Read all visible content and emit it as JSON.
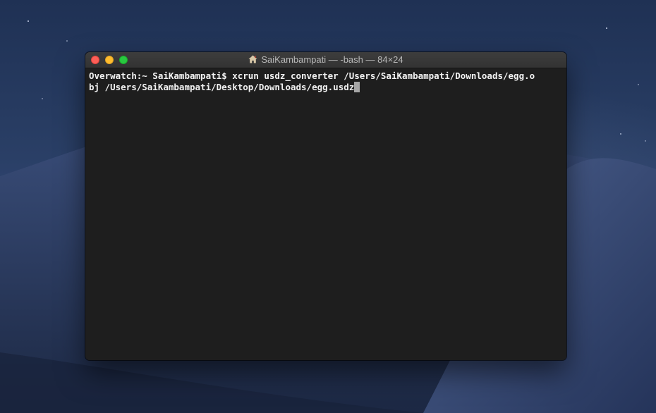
{
  "window": {
    "title": "SaiKambampati — -bash — 84×24",
    "title_icon": "home-icon"
  },
  "terminal": {
    "lines": [
      "Overwatch:~ SaiKambampati$ xcrun usdz_converter /Users/SaiKambampati/Downloads/egg.o",
      "bj /Users/SaiKambampati/Desktop/Downloads/egg.usdz"
    ]
  },
  "colors": {
    "terminal_background": "#1e1e1e",
    "terminal_text": "#f2f2f2",
    "cursor": "#a6a6a6",
    "close_button": "#fd5f57",
    "minimize_button": "#febc2e",
    "zoom_button": "#28c840"
  }
}
